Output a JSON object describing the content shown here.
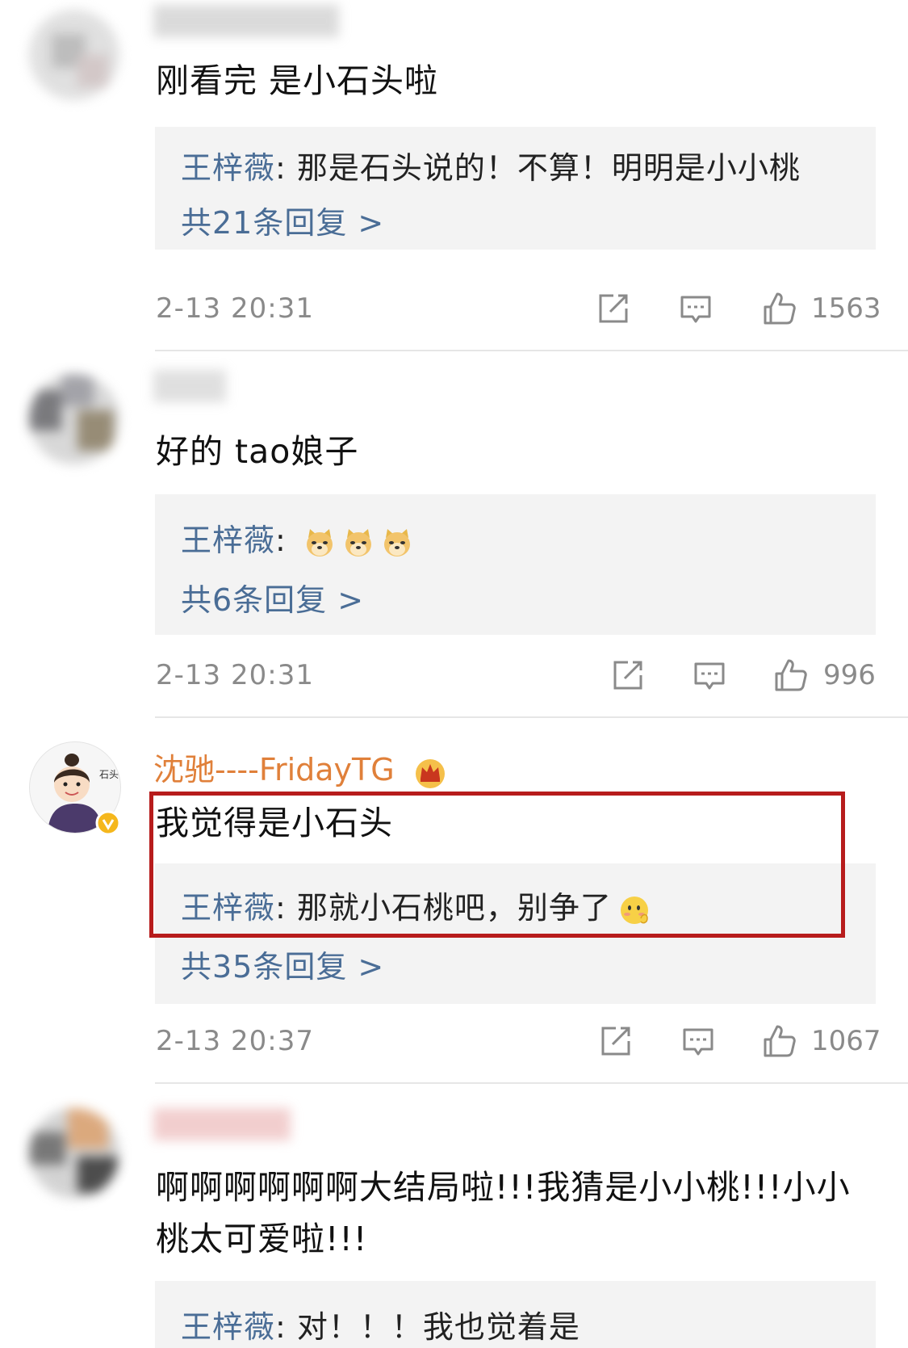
{
  "comments": [
    {
      "text": "刚看完  是小石头啦",
      "reply_author": "王梓薇",
      "reply_text": ": 那是石头说的！不算！明明是小小桃",
      "reply_count": "共21条回复 >",
      "timestamp": "2-13 20:31",
      "likes": "1563"
    },
    {
      "text": "好的 tao娘子",
      "reply_author": "王梓薇",
      "reply_text": ":",
      "reply_emojis": [
        "doge-emoji",
        "doge-emoji",
        "doge-emoji"
      ],
      "reply_count": "共6条回复 >",
      "timestamp": "2-13 20:31",
      "likes": "996"
    },
    {
      "username": "沈驰----FridayTG",
      "text": "我觉得是小石头",
      "reply_author": "王梓薇",
      "reply_text": ": 那就小石桃吧，别争了",
      "reply_count": "共35条回复 >",
      "timestamp": "2-13 20:37",
      "likes": "1067",
      "avatar_label": "石头"
    },
    {
      "text_line1": "啊啊啊啊啊啊大结局啦!!!我猜是小小桃!!!小小",
      "text_line2": "桃太可爱啦!!!",
      "reply_author": "王梓薇",
      "reply_text": ": 对！！！我也觉着是"
    }
  ],
  "icons": {
    "share": "share-icon",
    "comment": "comment-icon",
    "like": "thumbs-up-icon",
    "verified": "verified-badge-icon",
    "crown": "crown-badge-icon"
  },
  "colors": {
    "reply_author": "#4a6d96",
    "username": "#e0803a",
    "highlight": "#b71c1c",
    "reply_bg": "#f3f3f3",
    "meta": "#8a8a8a"
  }
}
